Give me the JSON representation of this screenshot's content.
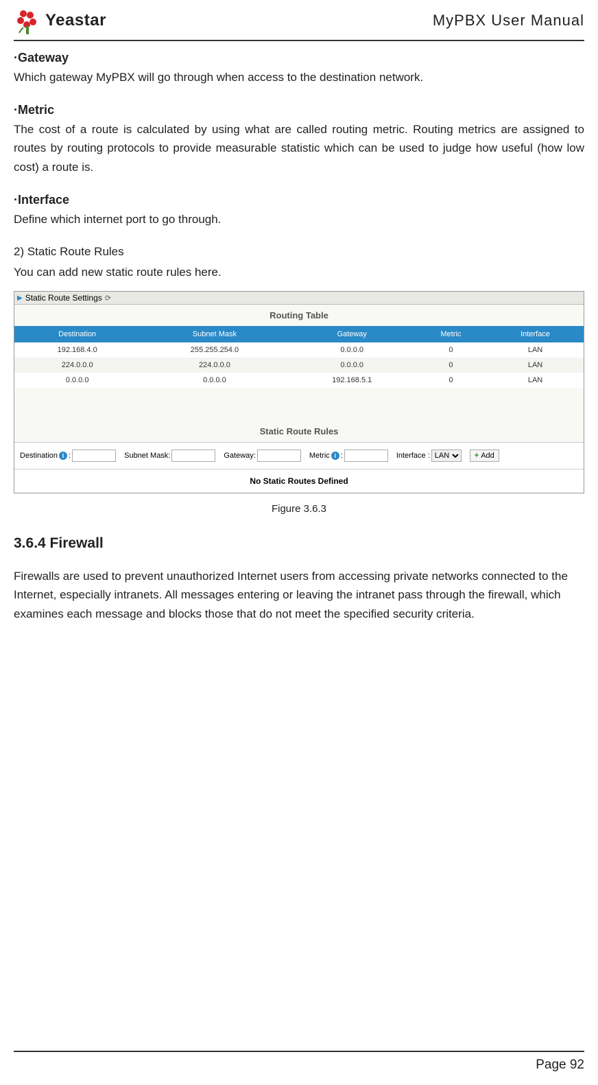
{
  "header": {
    "logo_text": "Yeastar",
    "title": "MyPBX User Manual"
  },
  "sections": {
    "gateway": {
      "heading": "·Gateway",
      "body": "Which gateway MyPBX will go through when access to the destination network."
    },
    "metric": {
      "heading": "·Metric",
      "body": "The cost of a route is calculated by using what are called routing metric. Routing metrics are assigned to routes by routing protocols to provide measurable statistic which can be used to judge how useful (how low cost) a route is."
    },
    "interface": {
      "heading": "·Interface",
      "body": "Define which internet port to go through."
    },
    "static_route": {
      "heading": "2)  Static Route Rules",
      "body": "You can add new static route rules here."
    },
    "firewall": {
      "heading": "3.6.4 Firewall",
      "body": "Firewalls are used to prevent unauthorized Internet users from accessing private networks connected to the Internet, especially intranets. All messages entering or leaving the intranet pass through the firewall, which examines each message and blocks those that do not meet the specified security criteria."
    }
  },
  "panel": {
    "title": "Static Route Settings",
    "routing_table_title": "Routing Table",
    "static_rules_title": "Static Route Rules",
    "no_routes": "No Static Routes Defined",
    "columns": {
      "destination": "Destination",
      "subnet_mask": "Subnet Mask",
      "gateway": "Gateway",
      "metric": "Metric",
      "interface": "Interface"
    },
    "rows": [
      {
        "destination": "192.168.4.0",
        "subnet_mask": "255.255.254.0",
        "gateway": "0.0.0.0",
        "metric": "0",
        "interface": "LAN"
      },
      {
        "destination": "224.0.0.0",
        "subnet_mask": "224.0.0.0",
        "gateway": "0.0.0.0",
        "metric": "0",
        "interface": "LAN"
      },
      {
        "destination": "0.0.0.0",
        "subnet_mask": "0.0.0.0",
        "gateway": "192.168.5.1",
        "metric": "0",
        "interface": "LAN"
      }
    ],
    "form": {
      "destination_label": "Destination",
      "subnet_label": "Subnet Mask:",
      "gateway_label": "Gateway:",
      "metric_label": "Metric",
      "interface_label": "Interface :",
      "interface_selected": "LAN",
      "add_label": "Add"
    }
  },
  "figure_caption": "Figure 3.6.3",
  "footer": {
    "page": "Page 92"
  }
}
